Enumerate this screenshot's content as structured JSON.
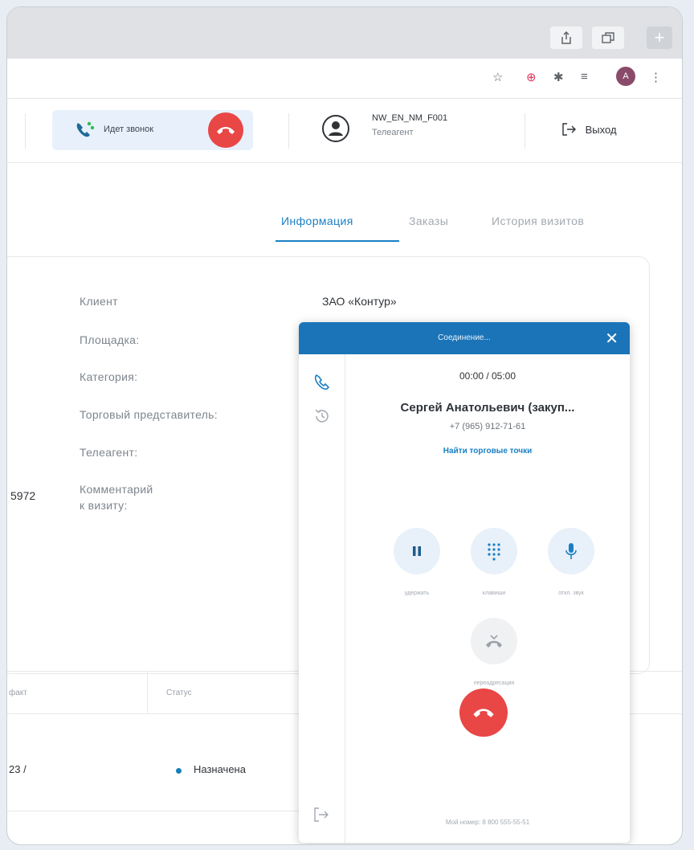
{
  "browser": {
    "ext_avatar_letter": "A"
  },
  "header": {
    "call_status": "Идет звонок",
    "user_name": "NW_EN_NM_F001",
    "user_role": "Телеагент",
    "logout_label": "Выход"
  },
  "tabs": [
    {
      "label": "Информация",
      "active": true
    },
    {
      "label": "Заказы",
      "active": false
    },
    {
      "label": "История визитов",
      "active": false
    }
  ],
  "info": {
    "fields": [
      {
        "label": "Клиент",
        "value": "ЗАО «Контур»"
      },
      {
        "label": "Площадка:",
        "value": ""
      },
      {
        "label": "Категория:",
        "value": ""
      },
      {
        "label": "Торговый представитель:",
        "value": ""
      },
      {
        "label": "Телеагент:",
        "value": ""
      },
      {
        "label": "Комментарий",
        "value": ""
      }
    ],
    "comment_line2": "к визиту:",
    "left_value": "5972"
  },
  "table": {
    "col_fact": "факт",
    "col_status": "Статус",
    "row_fact": "23 /",
    "row_status": "Назначена",
    "status_color": "#157fb8"
  },
  "phone": {
    "title": "Соединение...",
    "timer": "00:00 / 05:00",
    "caller": "Сергей Анатольевич (закуп...",
    "number": "+7 (965) 912-71-61",
    "find_points": "Найти торговые точки",
    "btn_hold": "удержать",
    "btn_keypad": "клавиши",
    "btn_mute": "откл. звук",
    "btn_transfer": "переадресация",
    "my_number": "Мой номер: 8 800 555-55-51"
  },
  "colors": {
    "accent": "#1a7fc4",
    "hangup": "#e94646",
    "phone_header": "#1c74b8"
  }
}
